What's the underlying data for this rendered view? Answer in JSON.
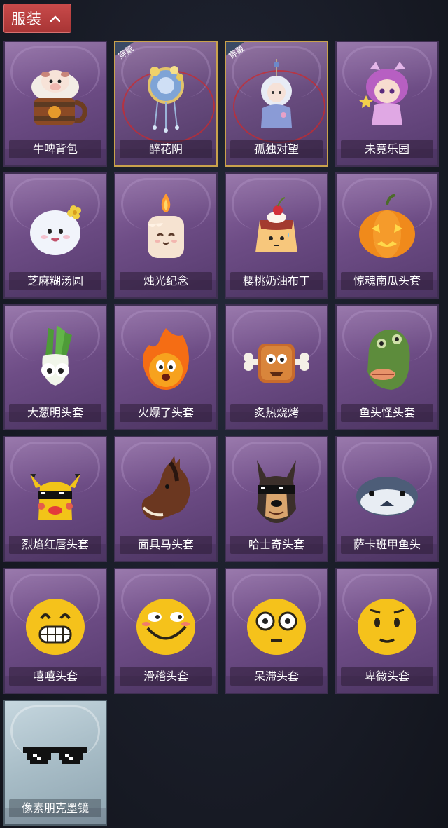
{
  "header": {
    "label": "服装",
    "accent": "#b43c3c"
  },
  "equipped_tag": "穿戴",
  "items": [
    {
      "label": "牛啤背包",
      "icon": "beer-mug-backpack-icon",
      "equipped": false
    },
    {
      "label": "醉花阴",
      "icon": "flower-dreamcatcher-icon",
      "equipped": true
    },
    {
      "label": "孤独对望",
      "icon": "doll-pendant-icon",
      "equipped": true
    },
    {
      "label": "未竟乐园",
      "icon": "girl-doll-icon",
      "equipped": false
    },
    {
      "label": "芝麻糊汤圆",
      "icon": "rice-ball-icon",
      "equipped": false
    },
    {
      "label": "烛光纪念",
      "icon": "candle-icon",
      "equipped": false
    },
    {
      "label": "樱桃奶油布丁",
      "icon": "pudding-icon",
      "equipped": false
    },
    {
      "label": "惊魂南瓜头套",
      "icon": "pumpkin-head-icon",
      "equipped": false
    },
    {
      "label": "大葱明头套",
      "icon": "scallion-head-icon",
      "equipped": false
    },
    {
      "label": "火爆了头套",
      "icon": "fireball-head-icon",
      "equipped": false
    },
    {
      "label": "炙热烧烤",
      "icon": "bbq-meat-icon",
      "equipped": false
    },
    {
      "label": "鱼头怪头套",
      "icon": "fish-head-mask-icon",
      "equipped": false
    },
    {
      "label": "烈焰红唇头套",
      "icon": "pikachu-mask-sunglasses-icon",
      "equipped": false
    },
    {
      "label": "面具马头套",
      "icon": "horse-head-mask-icon",
      "equipped": false
    },
    {
      "label": "哈士奇头套",
      "icon": "husky-head-sunglasses-icon",
      "equipped": false
    },
    {
      "label": "萨卡班甲鱼头",
      "icon": "sacabambaspis-head-icon",
      "equipped": false
    },
    {
      "label": "嘻嘻头套",
      "icon": "grinning-emoji-head-icon",
      "equipped": false
    },
    {
      "label": "滑稽头套",
      "icon": "funny-emoji-head-icon",
      "equipped": false
    },
    {
      "label": "呆滞头套",
      "icon": "dazed-emoji-head-icon",
      "equipped": false
    },
    {
      "label": "卑微头套",
      "icon": "humble-emoji-head-icon",
      "equipped": false
    },
    {
      "label": "像素朋克墨镜",
      "icon": "pixel-sunglasses-icon",
      "equipped": false,
      "style": "glass"
    }
  ]
}
